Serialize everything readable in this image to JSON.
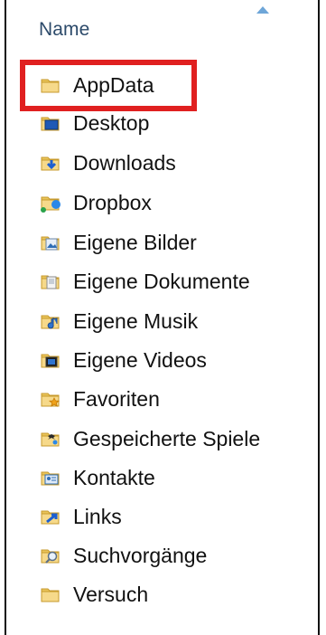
{
  "column": {
    "name_header": "Name",
    "sort_direction": "ascending"
  },
  "highlight_color": "#e02020",
  "items": [
    {
      "label": "AppData",
      "icon": "folder-icon",
      "highlighted": true
    },
    {
      "label": "Desktop",
      "icon": "desktop-folder-icon"
    },
    {
      "label": "Downloads",
      "icon": "downloads-folder-icon"
    },
    {
      "label": "Dropbox",
      "icon": "dropbox-folder-icon"
    },
    {
      "label": "Eigene Bilder",
      "icon": "pictures-folder-icon"
    },
    {
      "label": "Eigene Dokumente",
      "icon": "documents-folder-icon"
    },
    {
      "label": "Eigene Musik",
      "icon": "music-folder-icon"
    },
    {
      "label": "Eigene Videos",
      "icon": "videos-folder-icon"
    },
    {
      "label": "Favoriten",
      "icon": "favorites-folder-icon"
    },
    {
      "label": "Gespeicherte Spiele",
      "icon": "saved-games-folder-icon"
    },
    {
      "label": "Kontakte",
      "icon": "contacts-folder-icon"
    },
    {
      "label": "Links",
      "icon": "links-folder-icon"
    },
    {
      "label": "Suchvorgänge",
      "icon": "searches-folder-icon"
    },
    {
      "label": "Versuch",
      "icon": "folder-icon"
    }
  ]
}
